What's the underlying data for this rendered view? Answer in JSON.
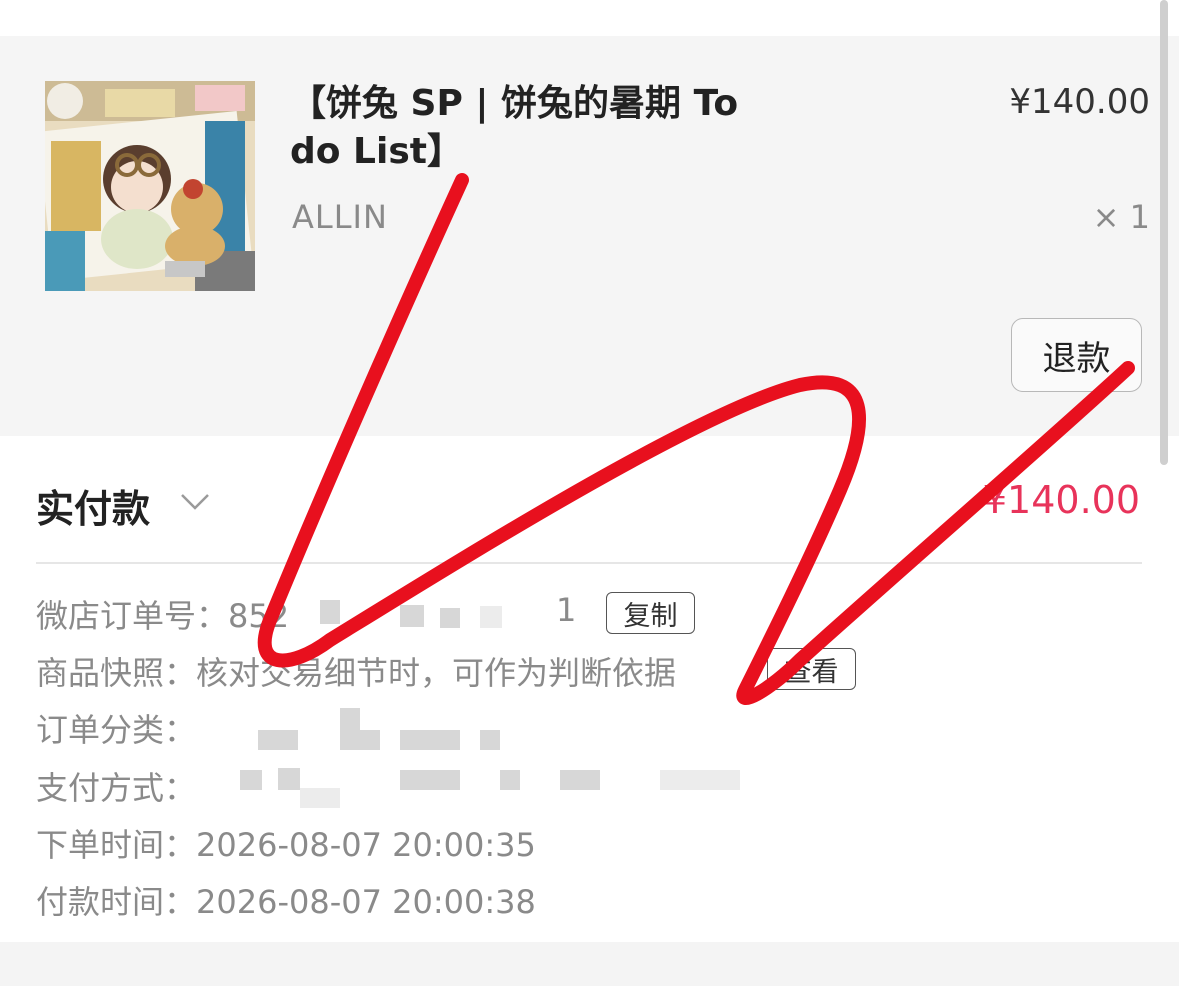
{
  "product": {
    "title": "【饼兔 SP | 饼兔的暑期 To do List】",
    "price": "¥140.00",
    "shop": "ALLIN",
    "quantity": "× 1",
    "refund_label": "退款",
    "thumbnail": "product-photo"
  },
  "payment": {
    "label": "实付款",
    "amount": "¥140.00",
    "amount_color": "#e8335a"
  },
  "order_info": {
    "order_no_label": "微店订单号：",
    "order_no_value": "852",
    "order_no_suffix": "1",
    "copy_label": "复制",
    "snapshot_label": "商品快照：",
    "snapshot_value": "核对交易细节时，可作为判断依据",
    "view_label": "查看",
    "category_label": "订单分类：",
    "pay_method_label": "支付方式：",
    "order_time_label": "下单时间：",
    "order_time_value": "2026-08-07 20:00:35",
    "pay_time_label": "付款时间：",
    "pay_time_value": "2026-08-07 20:00:38"
  },
  "annotation": {
    "stroke_color": "#e8101e"
  }
}
